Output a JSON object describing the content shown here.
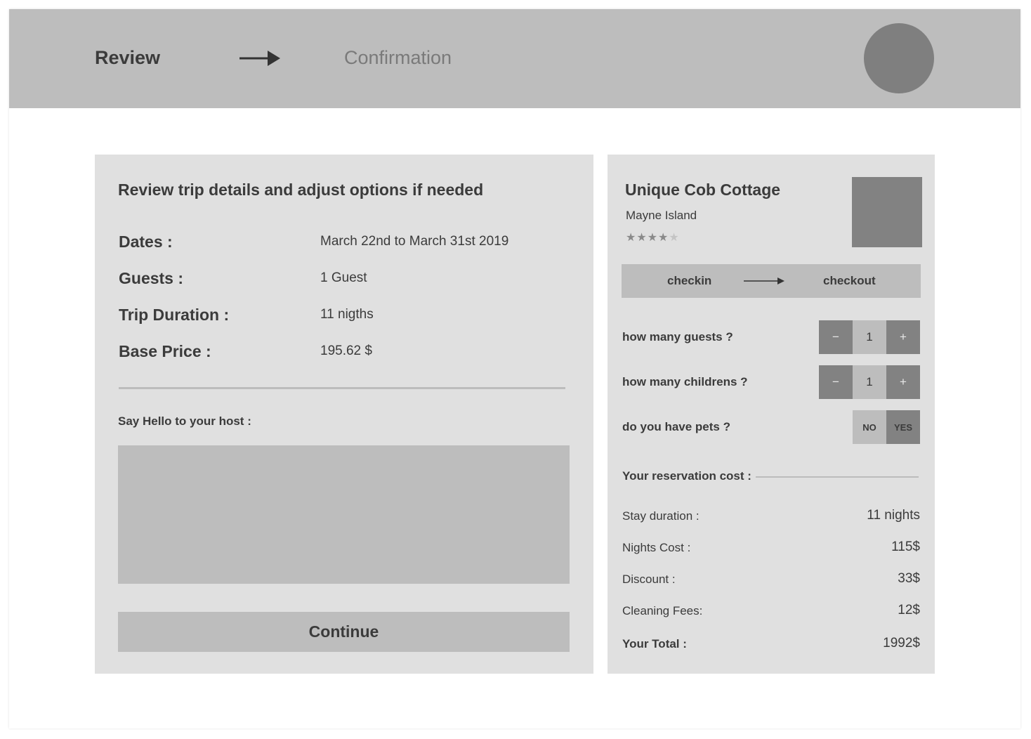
{
  "header": {
    "step_current": "Review",
    "step_next": "Confirmation"
  },
  "review": {
    "title": "Review trip details and adjust options if needed",
    "details": [
      {
        "label": "Dates :",
        "value": "March 22nd to March 31st 2019"
      },
      {
        "label": "Guests :",
        "value": "1 Guest"
      },
      {
        "label": "Trip Duration :",
        "value": "11 nigths"
      },
      {
        "label": "Base Price :",
        "value": "195.62 $"
      }
    ],
    "host_label": "Say Hello to your host :",
    "host_message_value": "",
    "continue_label": "Continue"
  },
  "listing": {
    "title": "Unique Cob Cottage",
    "location": "Mayne Island",
    "rating": 4,
    "rating_max": 5,
    "checkin_label": "checkin",
    "checkout_label": "checkout"
  },
  "options": {
    "guests": {
      "label": "how many guests ?",
      "value": "1",
      "minus": "−",
      "plus": "+"
    },
    "children": {
      "label": "how many childrens ?",
      "value": "1",
      "minus": "−",
      "plus": "+"
    },
    "pets": {
      "label": "do you have pets ?",
      "no_label": "NO",
      "yes_label": "YES",
      "selected": "YES"
    }
  },
  "cost": {
    "heading": "Your reservation cost :",
    "rows": [
      {
        "label": "Stay duration  :",
        "value": "11 nights"
      },
      {
        "label": "Nights Cost  :",
        "value": "115$"
      },
      {
        "label": "Discount :",
        "value": "33$"
      },
      {
        "label": "Cleaning Fees:",
        "value": "12$"
      }
    ],
    "total": {
      "label": "Your Total :",
      "value": "1992$"
    }
  },
  "colors": {
    "header_bg": "#bdbdbd",
    "panel_bg": "#e0e0e0",
    "dark_block": "#828282",
    "text": "#3b3b3b"
  }
}
